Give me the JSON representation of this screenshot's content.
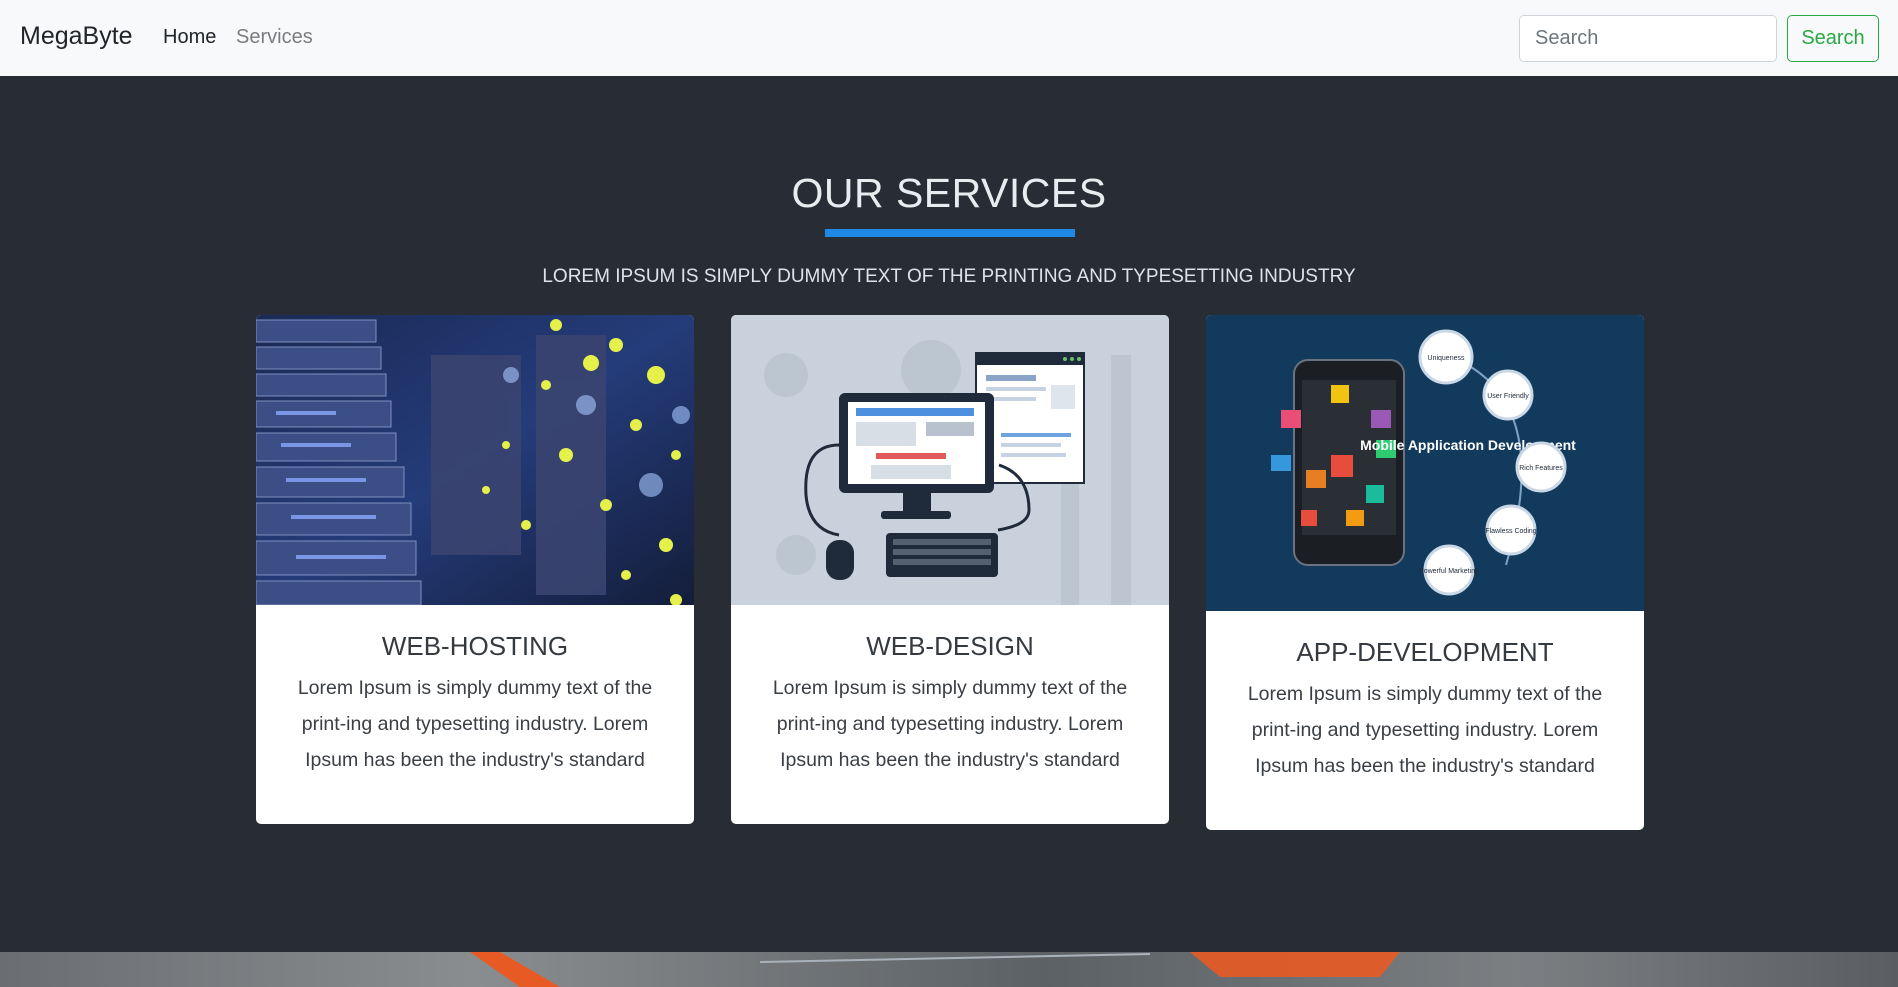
{
  "navbar": {
    "brand": "MegaByte",
    "links": [
      {
        "label": "Home"
      },
      {
        "label": "Services"
      }
    ],
    "search": {
      "placeholder": "Search",
      "button_label": "Search"
    }
  },
  "section": {
    "title": "OUR SERVICES",
    "subtitle": "LOREM IPSUM IS SIMPLY DUMMY TEXT OF THE PRINTING AND TYPESETTING INDUSTRY",
    "accent_color": "#1e88e5",
    "cards": [
      {
        "image_label": "server racks photo",
        "title": "WEB-HOSTING",
        "text": "Lorem Ipsum is simply dummy text of the print-ing and typesetting industry. Lorem Ipsum has been the industry's standard"
      },
      {
        "image_label": "web design illustration",
        "title": "WEB-DESIGN",
        "text": "Lorem Ipsum is simply dummy text of the print-ing and typesetting industry. Lorem Ipsum has been the industry's standard"
      },
      {
        "image_label": "mobile app development infographic",
        "title": "APP-DEVELOPMENT",
        "text": "Lorem Ipsum is simply dummy text of the print-ing and typesetting industry. Lorem Ipsum has been the industry's standard",
        "infographic": {
          "center": "Mobile Application Development",
          "bubbles": [
            "Uniqueness",
            "User Friendly",
            "Rich Features",
            "Flawless Coding",
            "Powerful Marketing"
          ]
        }
      }
    ]
  },
  "colors": {
    "navbar_bg": "#f8f9fa",
    "page_bg": "#282d35",
    "search_button": "#28a745"
  }
}
